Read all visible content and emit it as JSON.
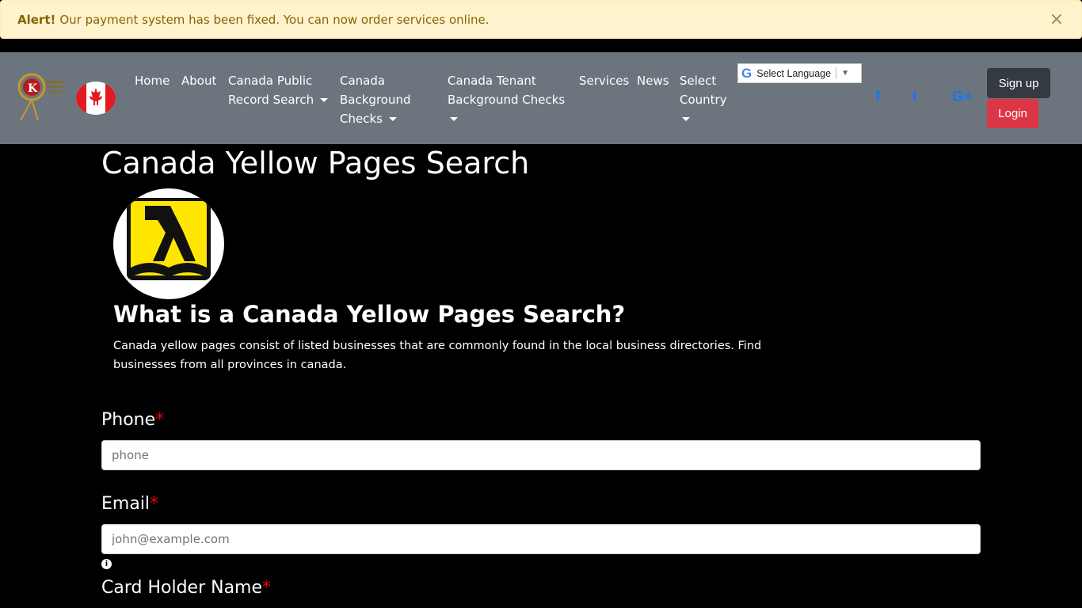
{
  "alert": {
    "strong": "Alert!",
    "message": "Our payment system has been fixed. You can now order services online.",
    "close": "×"
  },
  "nav": {
    "items": [
      {
        "line1": "Home",
        "line2": "",
        "line3": ""
      },
      {
        "line1": "About",
        "line2": "",
        "line3": ""
      },
      {
        "line1": "Canada Public",
        "line2": "Record Search",
        "line3": ""
      },
      {
        "line1": "Canada",
        "line2": "Background",
        "line3": "Checks"
      },
      {
        "line1": "Canada Tenant",
        "line2": "Background Checks",
        "line3": ""
      },
      {
        "line1": "Services",
        "line2": "",
        "line3": ""
      },
      {
        "line1": "News",
        "line2": "",
        "line3": ""
      },
      {
        "line1": "Select",
        "line2": "Country",
        "line3": ""
      }
    ],
    "language": "Select Language",
    "language_arrow": "▼",
    "google_g": "G",
    "social": {
      "facebook": "f",
      "twitter": "t",
      "google_plus": "G+"
    },
    "signup": "Sign up",
    "login": "Login"
  },
  "page": {
    "title": "Canada Yellow Pages Search",
    "subtitle": "What is a Canada Yellow Pages Search?",
    "description": "Canada yellow pages consist of listed businesses that are commonly found in the local business directories. Find businesses from all provinces in canada."
  },
  "form": {
    "phone_label": "Phone",
    "phone_placeholder": "phone",
    "email_label": "Email",
    "email_placeholder": "john@example.com",
    "card_label": "Card Holder Name",
    "required_mark": "*",
    "info_icon": "i"
  },
  "colors": {
    "navbar": "#6c757d",
    "alert_bg": "#fff3cd",
    "login": "#dc3545",
    "signup": "#343a40",
    "facebook": "#1877f2"
  }
}
